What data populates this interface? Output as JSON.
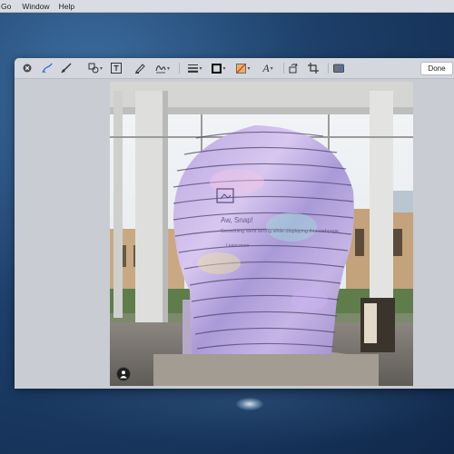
{
  "menubar": {
    "items": [
      "Go",
      "Window",
      "Help"
    ]
  },
  "toolbar": {
    "done_label": "Done",
    "icons": [
      "close-icon",
      "sketch-icon",
      "draw-icon",
      "shapes-icon",
      "text-icon",
      "highlight-icon",
      "sign-icon",
      "line-style-icon",
      "border-color-icon",
      "fill-color-icon",
      "text-style-icon",
      "rotate-icon",
      "crop-icon",
      "annotate-icon"
    ]
  },
  "photo_overlay": {
    "heading": "Aw, Snap!",
    "message": "Something went wrong while displaying this webpage.",
    "link": "Learn more"
  },
  "colors": {
    "accent": "#2e6fd8",
    "window_bg": "#c8ccd3",
    "toolbar_bg": "#d4d7dd"
  }
}
